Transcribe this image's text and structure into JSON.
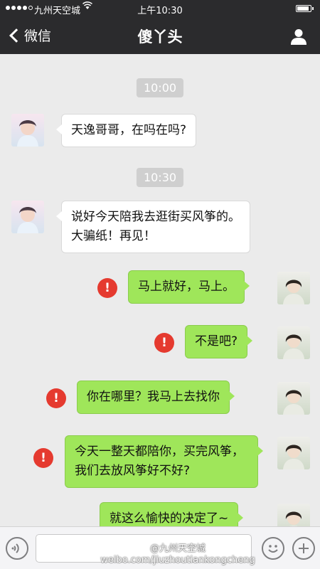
{
  "status_bar": {
    "carrier": "九州天空城",
    "time": "上午10:30"
  },
  "nav": {
    "back_label": "微信",
    "title": "傻丫头"
  },
  "messages": [
    {
      "type": "timestamp",
      "text": "10:00"
    },
    {
      "type": "incoming",
      "text": "天逸哥哥，在吗在吗?"
    },
    {
      "type": "timestamp",
      "text": "10:30"
    },
    {
      "type": "incoming",
      "text": "说好今天陪我去逛街买风筝的。大骗纸！再见！"
    },
    {
      "type": "outgoing",
      "text": "马上就好，马上。",
      "failed": true
    },
    {
      "type": "outgoing",
      "text": "不是吧?",
      "failed": true
    },
    {
      "type": "outgoing",
      "text": "你在哪里？我马上去找你",
      "failed": true
    },
    {
      "type": "outgoing",
      "text": "今天一整天都陪你，买完风筝，我们去放风筝好不好?",
      "failed": true
    },
    {
      "type": "outgoing",
      "text": "就这么愉快的决定了~",
      "failed": false
    }
  ],
  "error_symbol": "!",
  "colors": {
    "header_bg": "#2b2b2d",
    "chat_bg": "#ebebeb",
    "outgoing_bubble": "#9fe65a",
    "incoming_bubble": "#ffffff",
    "error_badge": "#e53a2f"
  },
  "input_bar": {
    "voice_icon": "voice-icon",
    "emoji_icon": "emoji-icon",
    "plus_icon": "plus-icon",
    "input_value": ""
  },
  "watermark": {
    "line1": "@九州天空城",
    "line2": "weibo.com/jiuzhoutiankongcheng"
  }
}
